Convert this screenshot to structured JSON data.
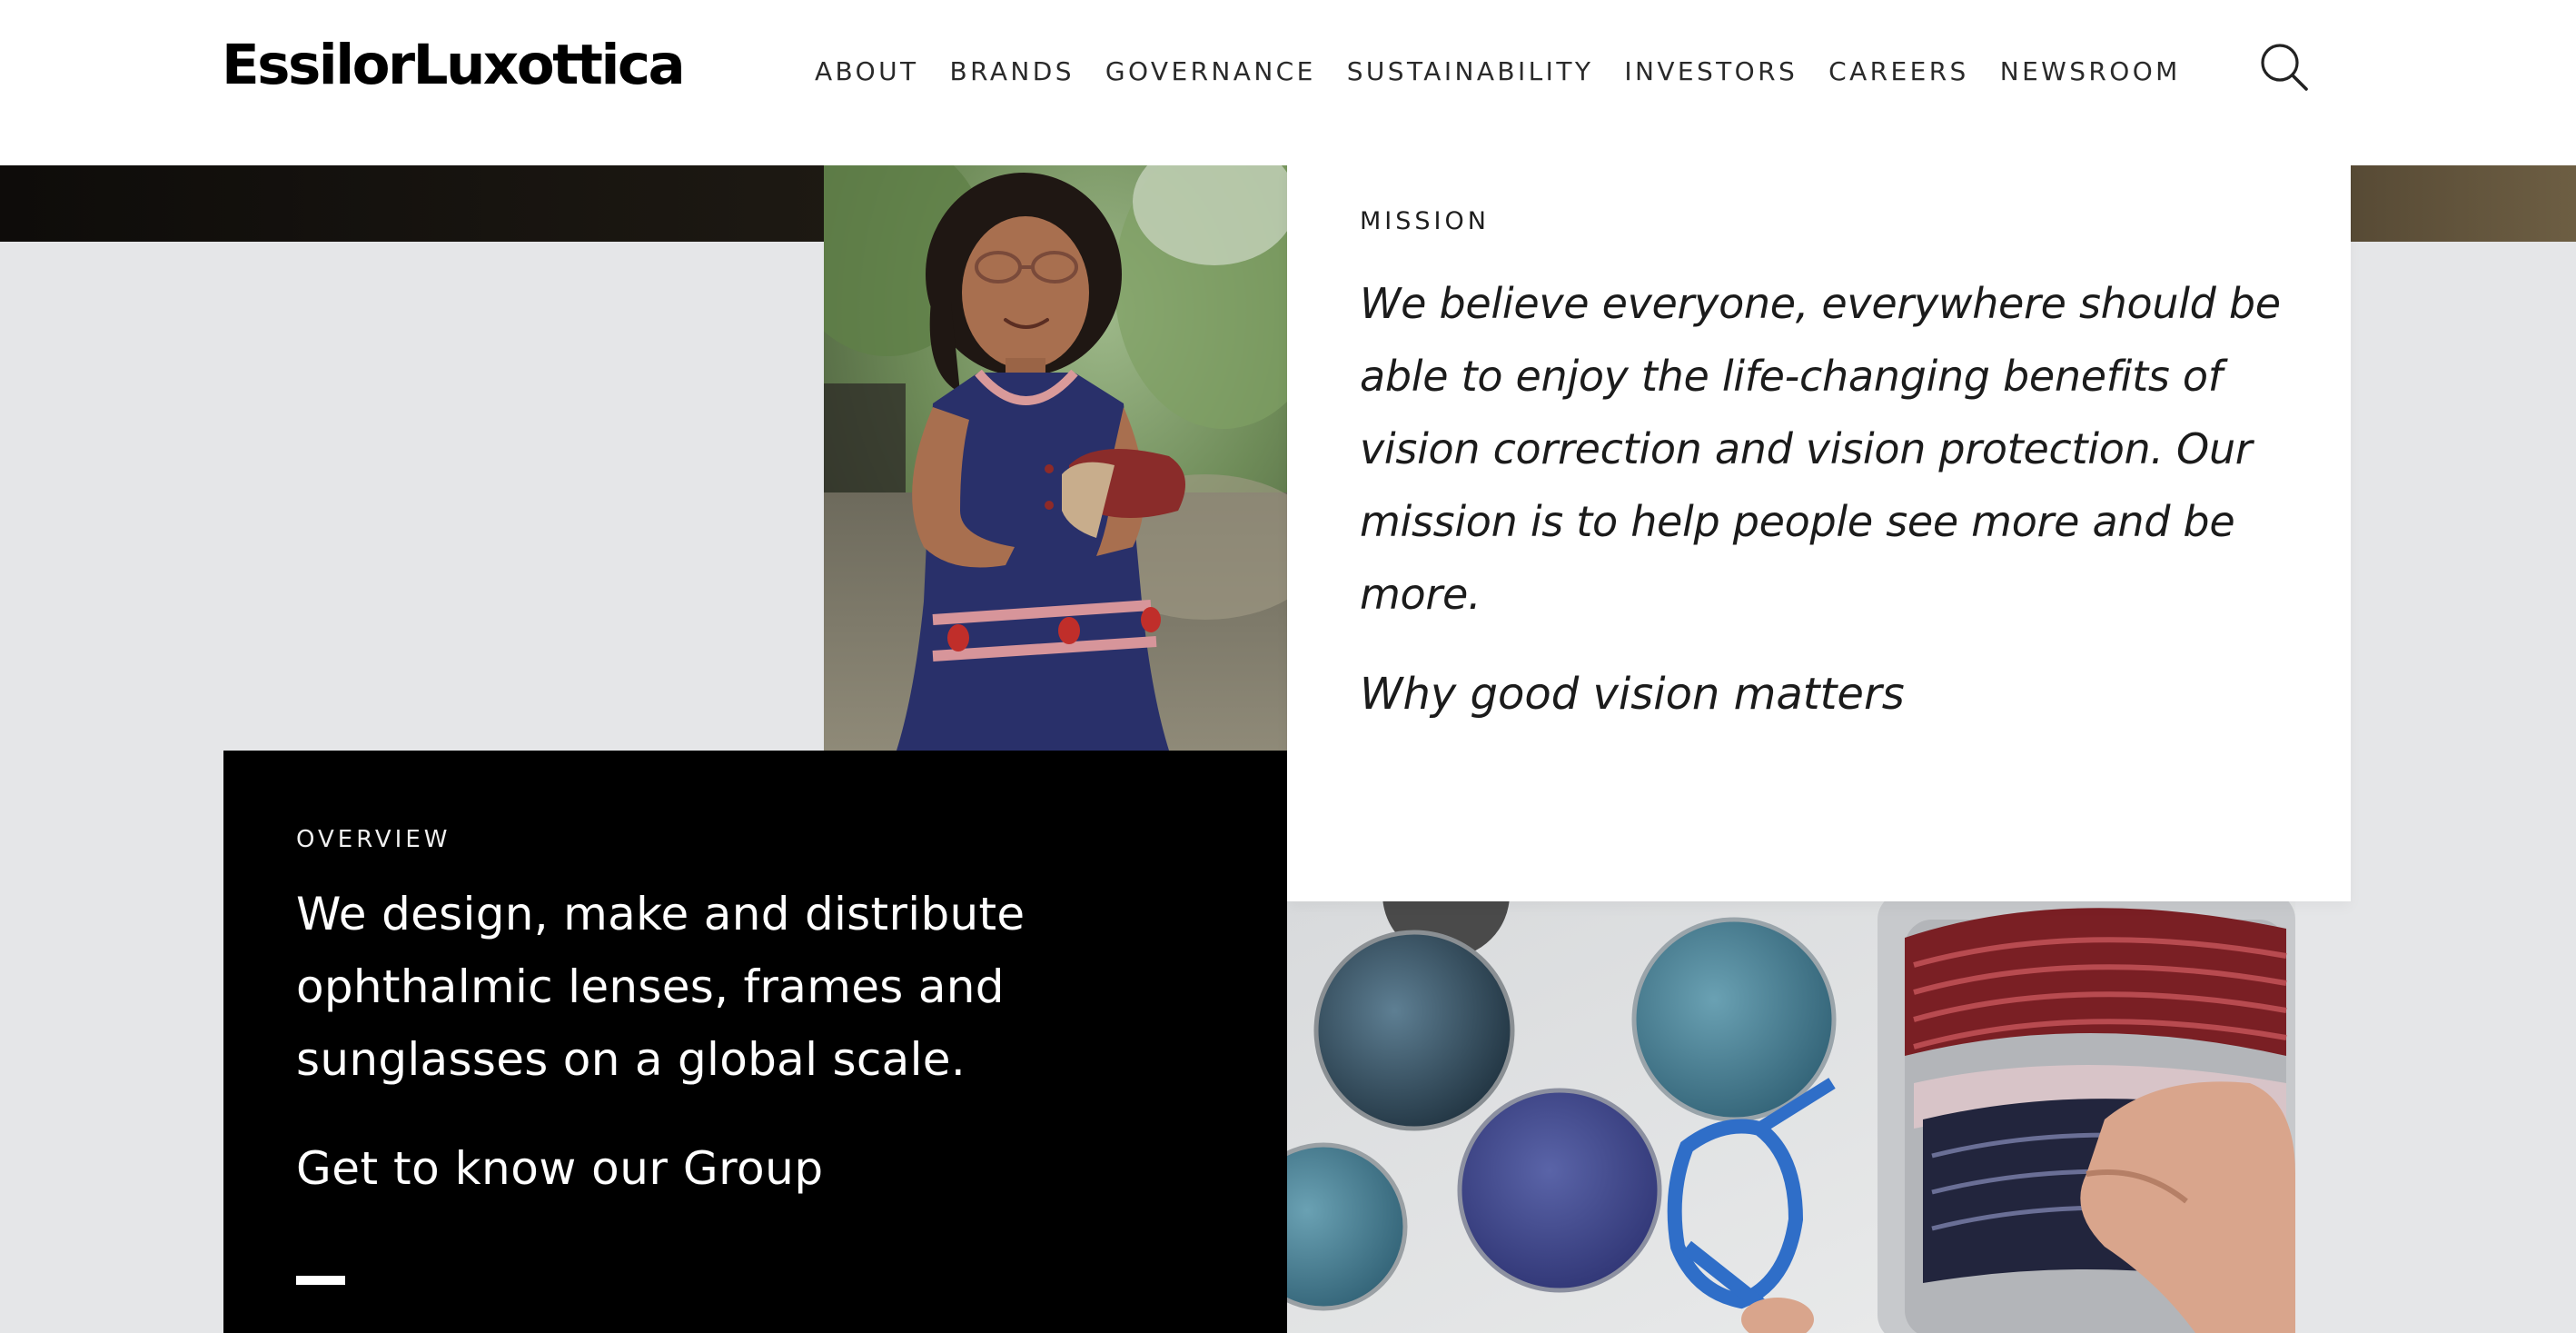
{
  "brand": {
    "logo_text": "EssilorLuxottica"
  },
  "nav": {
    "items": [
      {
        "label": "ABOUT"
      },
      {
        "label": "BRANDS"
      },
      {
        "label": "GOVERNANCE"
      },
      {
        "label": "SUSTAINABILITY"
      },
      {
        "label": "INVESTORS"
      },
      {
        "label": "CAREERS"
      },
      {
        "label": "NEWSROOM"
      }
    ],
    "search_icon": "search-icon"
  },
  "mission": {
    "eyebrow": "MISSION",
    "text": "We believe everyone, everywhere should be able to enjoy the life-changing benefits of vision correction and vision protection. Our mission is to help people see more and be more.",
    "link_label": "Why good vision matters"
  },
  "overview": {
    "eyebrow": "OVERVIEW",
    "text": "We design, make and distribute ophthalmic lenses, frames and sunglasses on a global scale.",
    "link_label": "Get to know our Group"
  },
  "colors": {
    "page_background": "#e5e6e8",
    "header_background": "#ffffff",
    "card_dark": "#000000",
    "card_light": "#ffffff",
    "hero_strip_dark": "#0e0c0a",
    "hero_strip_light": "#6d5e43"
  }
}
